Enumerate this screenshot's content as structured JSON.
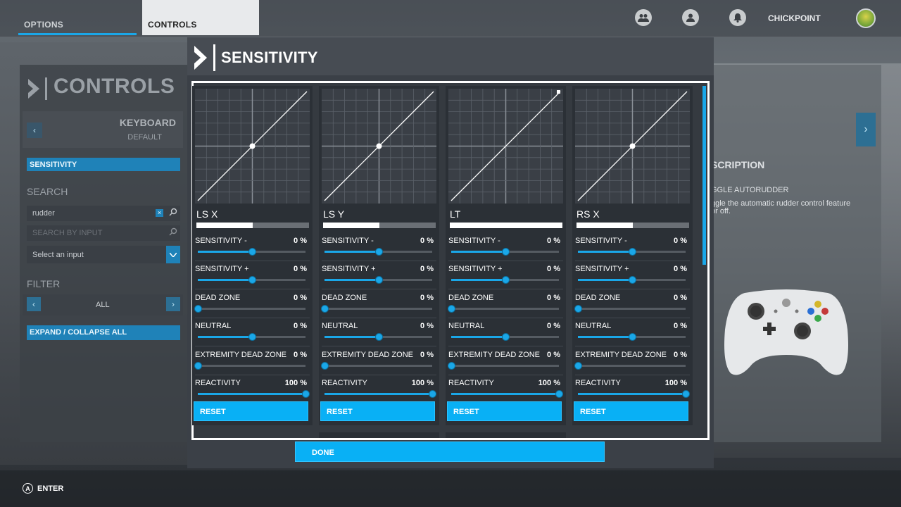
{
  "topbar": {
    "tabs": [
      {
        "label": "OPTIONS"
      },
      {
        "label": "CONTROLS"
      }
    ],
    "username": "CHICKPOINT",
    "icons": [
      "friends-icon",
      "profile-icon",
      "notification-icon"
    ]
  },
  "left_panel": {
    "title": "CONTROLS",
    "device": "KEYBOARD",
    "profile": "DEFAULT",
    "sensitivity_label": "SENSITIVITY",
    "search_title": "SEARCH",
    "search_value": "rudder",
    "search_by_input_placeholder": "SEARCH BY INPUT",
    "select_input": "Select an input",
    "filter_title": "FILTER",
    "filter_value": "ALL",
    "expand_label": "EXPAND / COLLAPSE ALL"
  },
  "right_panel": {
    "heading": "SCRIPTION",
    "item": "GGLE AUTORUDDER",
    "text_line1": "ggle the automatic rudder control feature",
    "text_line2": "or off."
  },
  "modal": {
    "title": "SENSITIVITY",
    "done_label": "DONE",
    "axes": [
      {
        "name": "LS X",
        "fill": 0.5,
        "center_point": true,
        "settings": [
          {
            "label": "SENSITIVITY -",
            "value": "0 %",
            "pos": 0.5
          },
          {
            "label": "SENSITIVITY +",
            "value": "0 %",
            "pos": 0.5
          },
          {
            "label": "DEAD ZONE",
            "value": "0 %",
            "pos": 0
          },
          {
            "label": "NEUTRAL",
            "value": "0 %",
            "pos": 0.5
          },
          {
            "label": "EXTREMITY DEAD ZONE",
            "value": "0 %",
            "pos": 0
          },
          {
            "label": "REACTIVITY",
            "value": "100 %",
            "pos": 1
          }
        ],
        "reset_label": "RESET"
      },
      {
        "name": "LS Y",
        "fill": 0.5,
        "center_point": true,
        "settings": [
          {
            "label": "SENSITIVITY -",
            "value": "0 %",
            "pos": 0.5
          },
          {
            "label": "SENSITIVITY +",
            "value": "0 %",
            "pos": 0.5
          },
          {
            "label": "DEAD ZONE",
            "value": "0 %",
            "pos": 0
          },
          {
            "label": "NEUTRAL",
            "value": "0 %",
            "pos": 0.5
          },
          {
            "label": "EXTREMITY DEAD ZONE",
            "value": "0 %",
            "pos": 0
          },
          {
            "label": "REACTIVITY",
            "value": "100 %",
            "pos": 1
          }
        ],
        "reset_label": "RESET"
      },
      {
        "name": "LT",
        "fill": 1,
        "center_point": false,
        "settings": [
          {
            "label": "SENSITIVITY -",
            "value": "0 %",
            "pos": 0.5
          },
          {
            "label": "SENSITIVITY +",
            "value": "0 %",
            "pos": 0.5
          },
          {
            "label": "DEAD ZONE",
            "value": "0 %",
            "pos": 0
          },
          {
            "label": "NEUTRAL",
            "value": "0 %",
            "pos": 0.5
          },
          {
            "label": "EXTREMITY DEAD ZONE",
            "value": "0 %",
            "pos": 0
          },
          {
            "label": "REACTIVITY",
            "value": "100 %",
            "pos": 1
          }
        ],
        "reset_label": "RESET"
      },
      {
        "name": "RS X",
        "fill": 0.5,
        "center_point": true,
        "settings": [
          {
            "label": "SENSITIVITY -",
            "value": "0 %",
            "pos": 0.5
          },
          {
            "label": "SENSITIVITY +",
            "value": "0 %",
            "pos": 0.5
          },
          {
            "label": "DEAD ZONE",
            "value": "0 %",
            "pos": 0
          },
          {
            "label": "NEUTRAL",
            "value": "0 %",
            "pos": 0.5
          },
          {
            "label": "EXTREMITY DEAD ZONE",
            "value": "0 %",
            "pos": 0
          },
          {
            "label": "REACTIVITY",
            "value": "100 %",
            "pos": 1
          }
        ],
        "reset_label": "RESET"
      }
    ]
  },
  "footer": {
    "button_glyph": "A",
    "action_label": "ENTER"
  },
  "colors": {
    "accent": "#09b0f5",
    "panel": "#3b4047",
    "column": "#2b3036"
  }
}
